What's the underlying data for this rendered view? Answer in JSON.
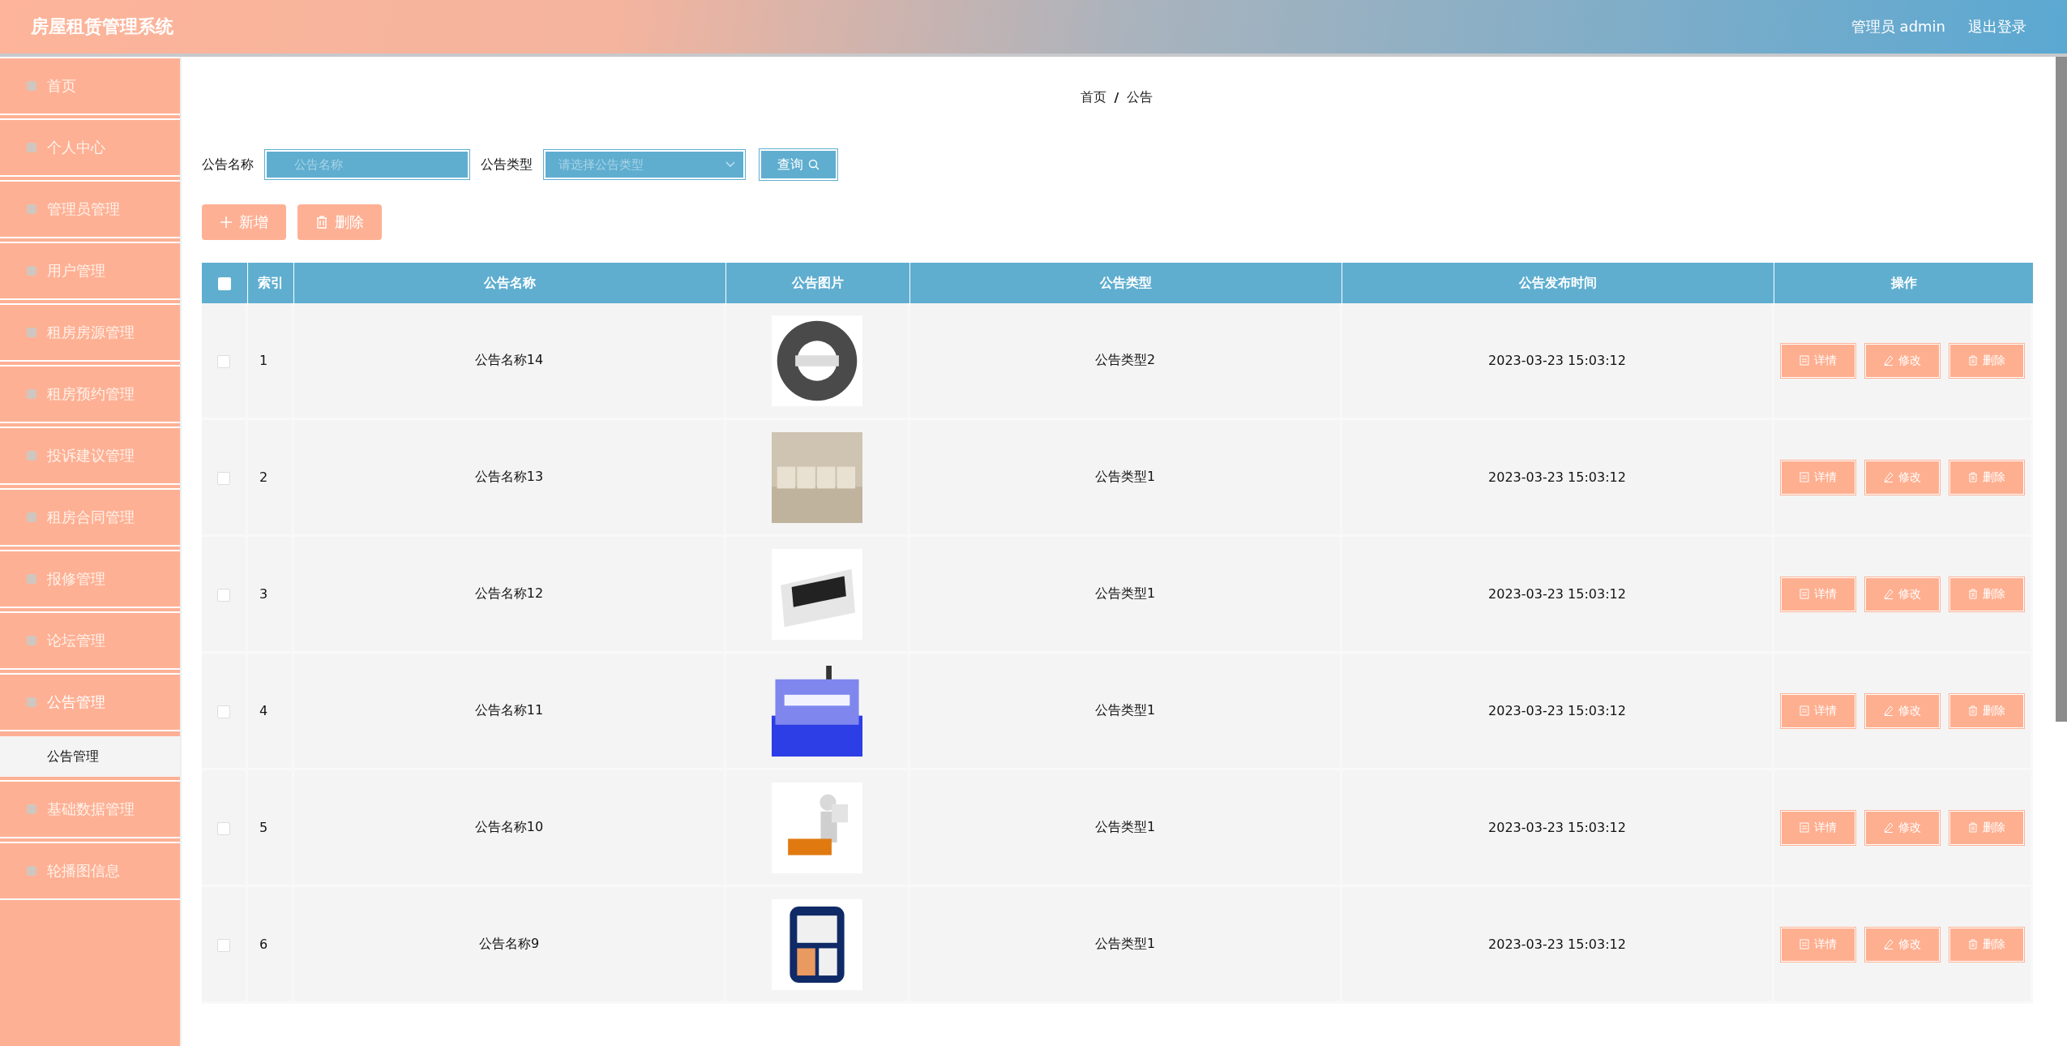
{
  "header": {
    "title": "房屋租赁管理系统",
    "user": "管理员 admin",
    "logout": "退出登录"
  },
  "sidebar": {
    "items": [
      {
        "label": "首页",
        "expanded": false
      },
      {
        "label": "个人中心",
        "expanded": false
      },
      {
        "label": "管理员管理",
        "expanded": false
      },
      {
        "label": "用户管理",
        "expanded": false
      },
      {
        "label": "租房房源管理",
        "expanded": false
      },
      {
        "label": "租房预约管理",
        "expanded": false
      },
      {
        "label": "投诉建议管理",
        "expanded": false
      },
      {
        "label": "租房合同管理",
        "expanded": false
      },
      {
        "label": "报修管理",
        "expanded": false
      },
      {
        "label": "论坛管理",
        "expanded": false
      },
      {
        "label": "公告管理",
        "expanded": true,
        "children": [
          {
            "label": "公告管理",
            "selected": true
          }
        ]
      },
      {
        "label": "基础数据管理",
        "expanded": false
      },
      {
        "label": "轮播图信息",
        "expanded": false
      }
    ]
  },
  "breadcrumb": [
    "首页",
    "/",
    "公告"
  ],
  "filters": {
    "name_label": "公告名称",
    "name_placeholder": "公告名称",
    "type_label": "公告类型",
    "type_placeholder": "请选择公告类型",
    "search_button": "查询"
  },
  "actions": [
    "新增",
    "删除"
  ],
  "table": {
    "all_checked": false,
    "columns": [
      "索引",
      "公告名称",
      "公告图片",
      "公告类型",
      "公告发布时间",
      "操作"
    ],
    "rows": [
      {
        "checked": false,
        "index": "1",
        "name": "公告名称14",
        "type": "公告类型2",
        "time": "2023-03-23 15:03:12",
        "buttons": [
          "详情",
          "修改",
          "删除"
        ]
      },
      {
        "checked": false,
        "index": "2",
        "name": "公告名称13",
        "type": "公告类型1",
        "time": "2023-03-23 15:03:12",
        "buttons": [
          "详情",
          "修改",
          "删除"
        ]
      },
      {
        "checked": false,
        "index": "3",
        "name": "公告名称12",
        "type": "公告类型1",
        "time": "2023-03-23 15:03:12",
        "buttons": [
          "详情",
          "修改",
          "删除"
        ]
      },
      {
        "checked": false,
        "index": "4",
        "name": "公告名称11",
        "type": "公告类型1",
        "time": "2023-03-23 15:03:12",
        "buttons": [
          "详情",
          "修改",
          "删除"
        ]
      },
      {
        "checked": false,
        "index": "5",
        "name": "公告名称10",
        "type": "公告类型1",
        "time": "2023-03-23 15:03:12",
        "buttons": [
          "详情",
          "修改",
          "删除"
        ]
      },
      {
        "checked": false,
        "index": "6",
        "name": "公告名称9",
        "type": "公告类型1",
        "time": "2023-03-23 15:03:12",
        "buttons": [
          "详情",
          "修改",
          "删除"
        ]
      }
    ]
  }
}
